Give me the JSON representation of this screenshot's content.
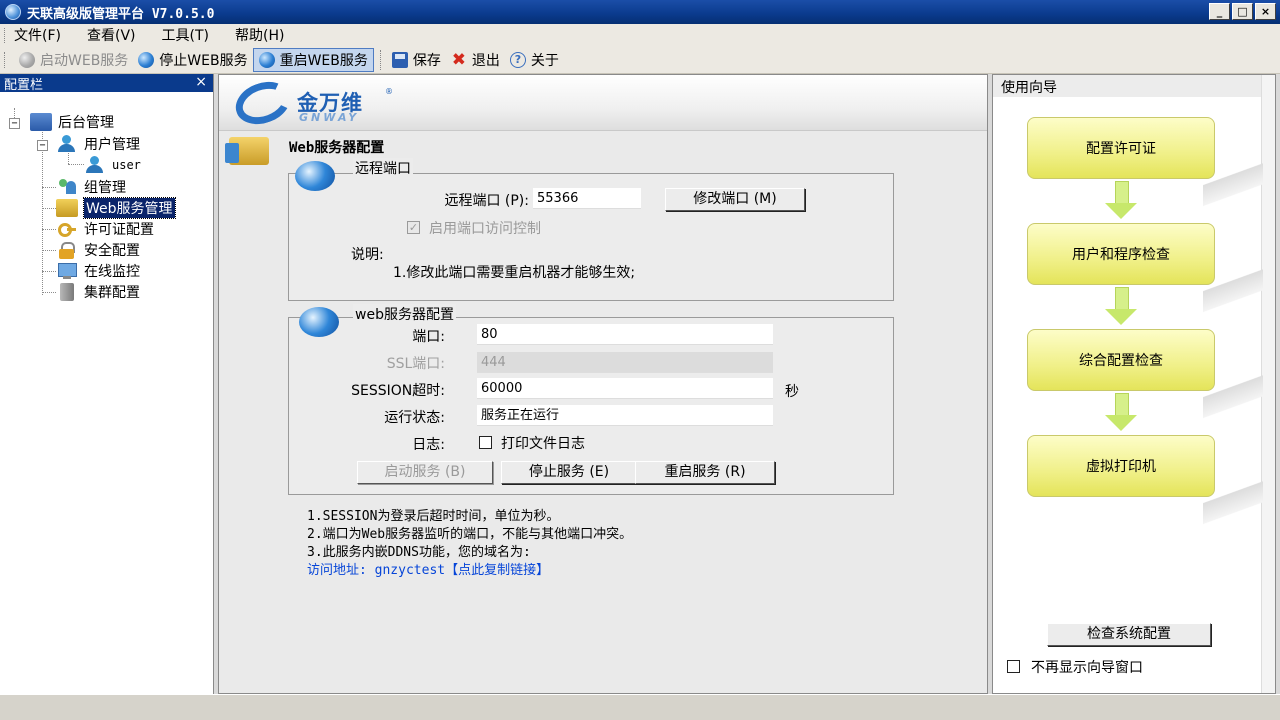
{
  "window": {
    "title": "天联高级版管理平台 V7.0.5.0",
    "buttons": [
      "_",
      "□",
      "×"
    ]
  },
  "menu": {
    "items": [
      "文件(F)",
      "查看(V)",
      "工具(T)",
      "帮助(H)"
    ]
  },
  "toolbar": {
    "start_web": "启动WEB服务",
    "stop_web": "停止WEB服务",
    "restart_web": "重启WEB服务",
    "save": "保存",
    "exit": "退出",
    "about": "关于"
  },
  "sidebar": {
    "title": "配置栏",
    "close": "×",
    "tree": {
      "root": "后台管理",
      "user_mgmt": "用户管理",
      "user": "user",
      "group_mgmt": "组管理",
      "web_mgmt": "Web服务管理",
      "license": "许可证配置",
      "security": "安全配置",
      "monitor": "在线监控",
      "cluster": "集群配置"
    }
  },
  "main": {
    "logo_cn": "金万维",
    "logo_en": "GNWAY",
    "logo_reg": "®",
    "section_title": "Web服务器配置",
    "remote": {
      "title": "远程端口",
      "port_label": "远程端口 (P):",
      "port_value": "55366",
      "modify_button": "修改端口 (M)",
      "access_control_label": "启用端口访问控制",
      "access_control_checked": true,
      "note_title": "说明:",
      "note_line": "1.修改此端口需要重启机器才能够生效;"
    },
    "web": {
      "title": "web服务器配置",
      "port_label": "端口:",
      "port_value": "80",
      "ssl_label": "SSL端口:",
      "ssl_value": "444",
      "session_label": "SESSION超时:",
      "session_value": "60000",
      "session_unit": "秒",
      "status_label": "运行状态:",
      "status_value": "服务正在运行",
      "log_label": "日志:",
      "log_checkbox": "打印文件日志",
      "log_checked": false,
      "start_button": "启动服务 (B)",
      "stop_button": "停止服务 (E)",
      "restart_button": "重启服务 (R)"
    },
    "notes": [
      "1.SESSION为登录后超时时间，单位为秒。",
      "2.端口为Web服务器监听的端口，不能与其他端口冲突。",
      "3.此服务内嵌DDNS功能，您的域名为:"
    ],
    "access_label": "访问地址:",
    "access_domain": "gnzyctest",
    "copy_link": "【点此复制链接】"
  },
  "wizard": {
    "title": "使用向导",
    "steps": [
      "配置许可证",
      "用户和程序检查",
      "综合配置检查",
      "虚拟打印机"
    ],
    "check_button": "检查系统配置",
    "no_show_label": "不再显示向导窗口",
    "no_show_checked": false
  },
  "colors": {
    "title_bar": "#0a3a8c",
    "selection": "#0a246a",
    "link": "#0645d8",
    "wizard_step": "#f0f088"
  }
}
